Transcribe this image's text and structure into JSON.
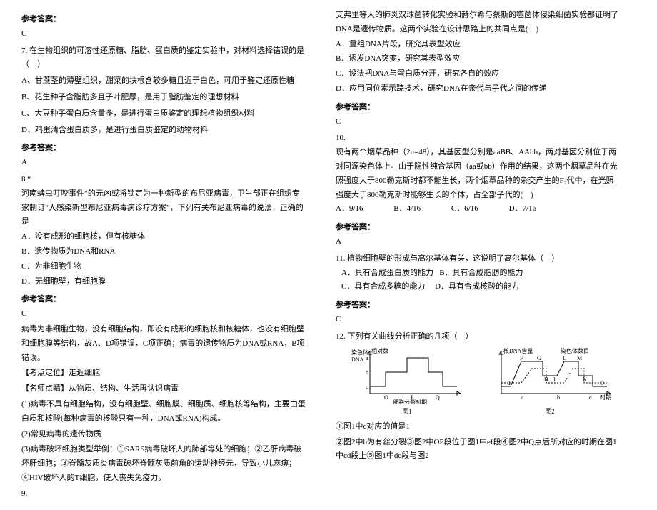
{
  "left": {
    "ans_label": "参考答案：",
    "a6": "C",
    "q7": "7. 在生物组织的可溶性还原糖、脂肪、蛋白质的鉴定实验中，对材料选择错误的是（　）",
    "q7A": "A、甘蔗茎的薄壁组织，甜菜的块根含较多糖且近于白色，可用于鉴定还原性糖",
    "q7B": "B、花生种子含脂肪多且子叶肥厚，是用于脂肪鉴定的理想材料",
    "q7C": "C、大豆种子蛋白质含量多，是进行蛋白质鉴定的理想植物组织材料",
    "q7D": "D、鸡蛋清含蛋白质多，是进行蛋白质鉴定的动物材料",
    "a7": "A",
    "q8n": "8.“",
    "q8a": "河南蜱虫叮咬事件”的元凶或将锁定为一种新型的布尼亚病毒，卫生部正在组织专家制订“人感染新型布尼亚病毒病诊疗方案”，下列有关布尼亚病毒的说法，正确的是",
    "q8A": "A．没有成形的细胞核，但有核糖体",
    "q8B": "B．遗传物质为DNA和RNA",
    "q8C": "C．为非细胞生物",
    "q8D": "D．无细胞壁，有细胞膜",
    "a8": "C",
    "exp1": "病毒为非细胞生物，没有细胞结构，即没有成形的细胞核和核糖体，也没有细胞壁和细胞膜等结构，故A、D项错误，C项正确；病毒的遗传物质为DNA或RNA，B项错误。",
    "exp2": "【考点定位】走近细胞",
    "exp3": "【名师点睛】从物质、结构、生活再认识病毒",
    "exp4": "(1)病毒不具有细胞结构，没有细胞壁、细胞膜、细胞质、细胞核等结构，主要由蛋白质和核酸(每种病毒的核酸只有一种，DNA或RNA)构成。",
    "exp5": "(2)常见病毒的遗传物质",
    "exp6": "(3)病毒破坏细胞类型举例：①SARS病毒破坏人的肺部等处的细胞；②乙肝病毒破坏肝细胞；③脊髓灰质炎病毒破坏脊髓灰质前角的运动神经元，导致小儿麻痹；④HIV破坏人的T细胞，使人丧失免疫力。",
    "q9n": "9."
  },
  "right": {
    "q9a": "艾弗里等人的肺炎双球菌转化实验和赫尔希与蔡斯的噬菌体侵染细菌实验都证明了DNA是遗传物质。这两个实验在设计思路上的共同点是(　)",
    "q9A": "A．重组DNA片段，研究其表型效应",
    "q9B": "B．诱发DNA突变，研究其表型效应",
    "q9C": "C．设法把DNA与蛋白质分开，研究各自的效应",
    "q9D": "D．应用同位素示踪技术，研究DNA在亲代与子代之间的传递",
    "ans_label": "参考答案：",
    "a9": "C",
    "q10n": "10.",
    "q10a": "现有两个烟草品种（2n=48），其基因型分别是aaBB、AAbb，两对基因分别位于两对同源染色体上。由于隐性纯合基因（aa或bb）作用的结果，这两个烟草品种在光照强度大于800勒克斯时都不能生长，两个烟草品种的杂交产生的F₂代中，在光照强度大于800勒克斯时能够生长的个体，占全部子代的(　)",
    "q10A": "A．9/16",
    "q10B": "B．4/16",
    "q10C": "C．6/16",
    "q10D": "D．7/16",
    "a10": "A",
    "q11": "11. 植物细胞壁的形成与高尔基体有关，这说明了高尔基体（　）",
    "q11A": "A．具有合成蛋白质的能力",
    "q11B": "B．具有合成脂肪的能力",
    "q11C": "C．具有合成多糖的能力",
    "q11D": "D．具有合成核酸的能力",
    "a11": "C",
    "q12": "12. 下列有关曲线分析正确的几项（　）",
    "chart1_y1": "染色体",
    "chart1_y2": "DNA",
    "chart1_y3": "相对数",
    "chart1_xa": "O",
    "chart1_xb": "P",
    "chart1_xc": "Q",
    "chart1_a": "a",
    "chart1_b": "b",
    "chart1_c": "c",
    "chart1_xl": "细胞分裂时期",
    "chart1_cap": "图1",
    "chart2_y": "核DNA含量",
    "chart2_y2": "染色体数目",
    "chart2_labels": [
      "E",
      "F",
      "G",
      "H",
      "I",
      "L",
      "M",
      "N",
      "O"
    ],
    "chart2_xa": "a",
    "chart2_xb": "b",
    "chart2_xc": "c",
    "chart2_xl": "时期",
    "chart2_cap": "图2",
    "q12sub": "①图1中c对应的值是1",
    "q12sub2": "②图2中b为有丝分裂③图2中OP段位于图1中ef段④图2中Q点后所对应的时期在图1中cd段上⑤图1中de段与图2"
  }
}
